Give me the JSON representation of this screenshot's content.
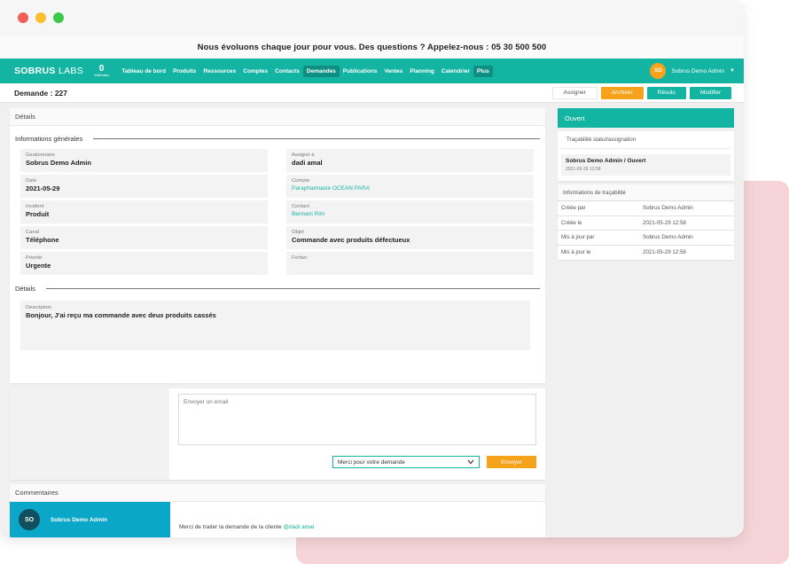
{
  "announcement": "Nous évoluons chaque jour pour vous. Des questions ? Appelez-nous : 05 30 500 500",
  "nav": {
    "brand_bold": "SOBRUS",
    "brand_light": "LABS",
    "counter_value": "0",
    "counter_label": "Notification",
    "items": [
      "Tableau de bord",
      "Produits",
      "Ressources",
      "Comptes",
      "Contacts",
      "Demandes",
      "Publications",
      "Ventes",
      "Planning",
      "Calendrier",
      "Plus"
    ],
    "user_initials": "SO",
    "user_name": "Sobrus Demo Admin"
  },
  "subbar": {
    "title": "Demande : 227",
    "assign_label": "Assigner",
    "archive_label": "Archiver",
    "resolve_label": "Résolu",
    "edit_label": "Modifier"
  },
  "details": {
    "card_title": "Détails",
    "general_title": "Informations générales",
    "fields_left": [
      {
        "label": "Gestionnaire",
        "value": "Sobrus Demo Admin"
      },
      {
        "label": "Date",
        "value": "2021-05-29"
      },
      {
        "label": "Incident",
        "value": "Produit"
      },
      {
        "label": "Canal",
        "value": "Téléphone"
      },
      {
        "label": "Priorité",
        "value": "Urgente"
      }
    ],
    "fields_right": [
      {
        "label": "Assigné à",
        "value": "dadi amal"
      },
      {
        "label": "Compte",
        "value": "Parapharmacie OCEAN PARA"
      },
      {
        "label": "Contact",
        "value": "Bennani Rim"
      },
      {
        "label": "Objet",
        "value": "Commande avec produits défectueux"
      },
      {
        "label": "Fichier",
        "value": ""
      }
    ],
    "details_title": "Détails",
    "description_label": "Description",
    "description_value": "Bonjour, J'ai reçu ma commande avec deux produits cassés"
  },
  "email": {
    "placeholder": "Envoyer un email",
    "template_selected": "Merci pour votre demande",
    "send_label": "Envoyer"
  },
  "comments": {
    "title": "Commentaires",
    "author_initials": "SO",
    "author_name": "Sobrus Demo Admin",
    "text": "Merci de traiter la demande de la cliente",
    "mention": "@dadi amal"
  },
  "status": {
    "label": "Ouvert",
    "trace_title": "Traçabilité statut/assignation",
    "trace_entry": "Sobrus Demo Admin / Ouvert",
    "trace_date": "2021-05-29 12:58"
  },
  "traceability": {
    "title": "Informations de traçabilité",
    "rows": [
      {
        "key": "Créée par",
        "value": "Sobrus Demo Admin"
      },
      {
        "key": "Créée le",
        "value": "2021-05-29 12:58"
      },
      {
        "key": "Mis à jour par",
        "value": "Sobrus Demo Admin"
      },
      {
        "key": "Mis à jour le",
        "value": "2021-05-29 12:58"
      }
    ]
  },
  "colors": {
    "primary": "#13b5a2",
    "accent": "#f6a21b",
    "comment_author_bg": "#0aa7c8"
  }
}
